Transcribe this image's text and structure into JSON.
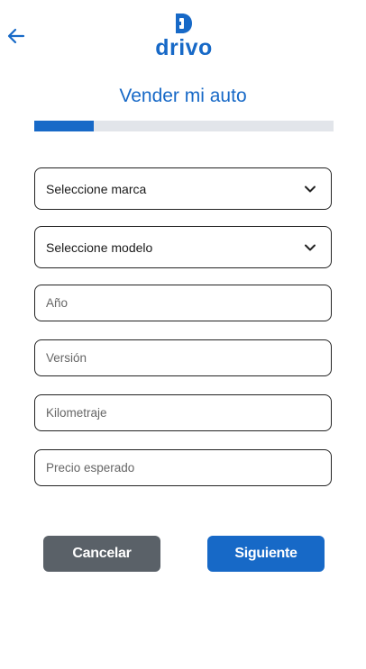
{
  "header": {
    "back_icon": "arrow-left-icon",
    "logo_text": "drivo"
  },
  "colors": {
    "brand": "#1769c7",
    "cancel": "#5a6168",
    "track": "#e2e5ea"
  },
  "page": {
    "title": "Vender mi auto"
  },
  "progress": {
    "fraction": 0.2
  },
  "form": {
    "brand_select": {
      "value": "Seleccione marca"
    },
    "model_select": {
      "value": "Seleccione modelo"
    },
    "year_placeholder": "Año",
    "version_placeholder": "Versión",
    "mileage_placeholder": "Kilometraje",
    "price_placeholder": "Precio esperado"
  },
  "actions": {
    "cancel_label": "Cancelar",
    "next_label": "Siguiente"
  }
}
